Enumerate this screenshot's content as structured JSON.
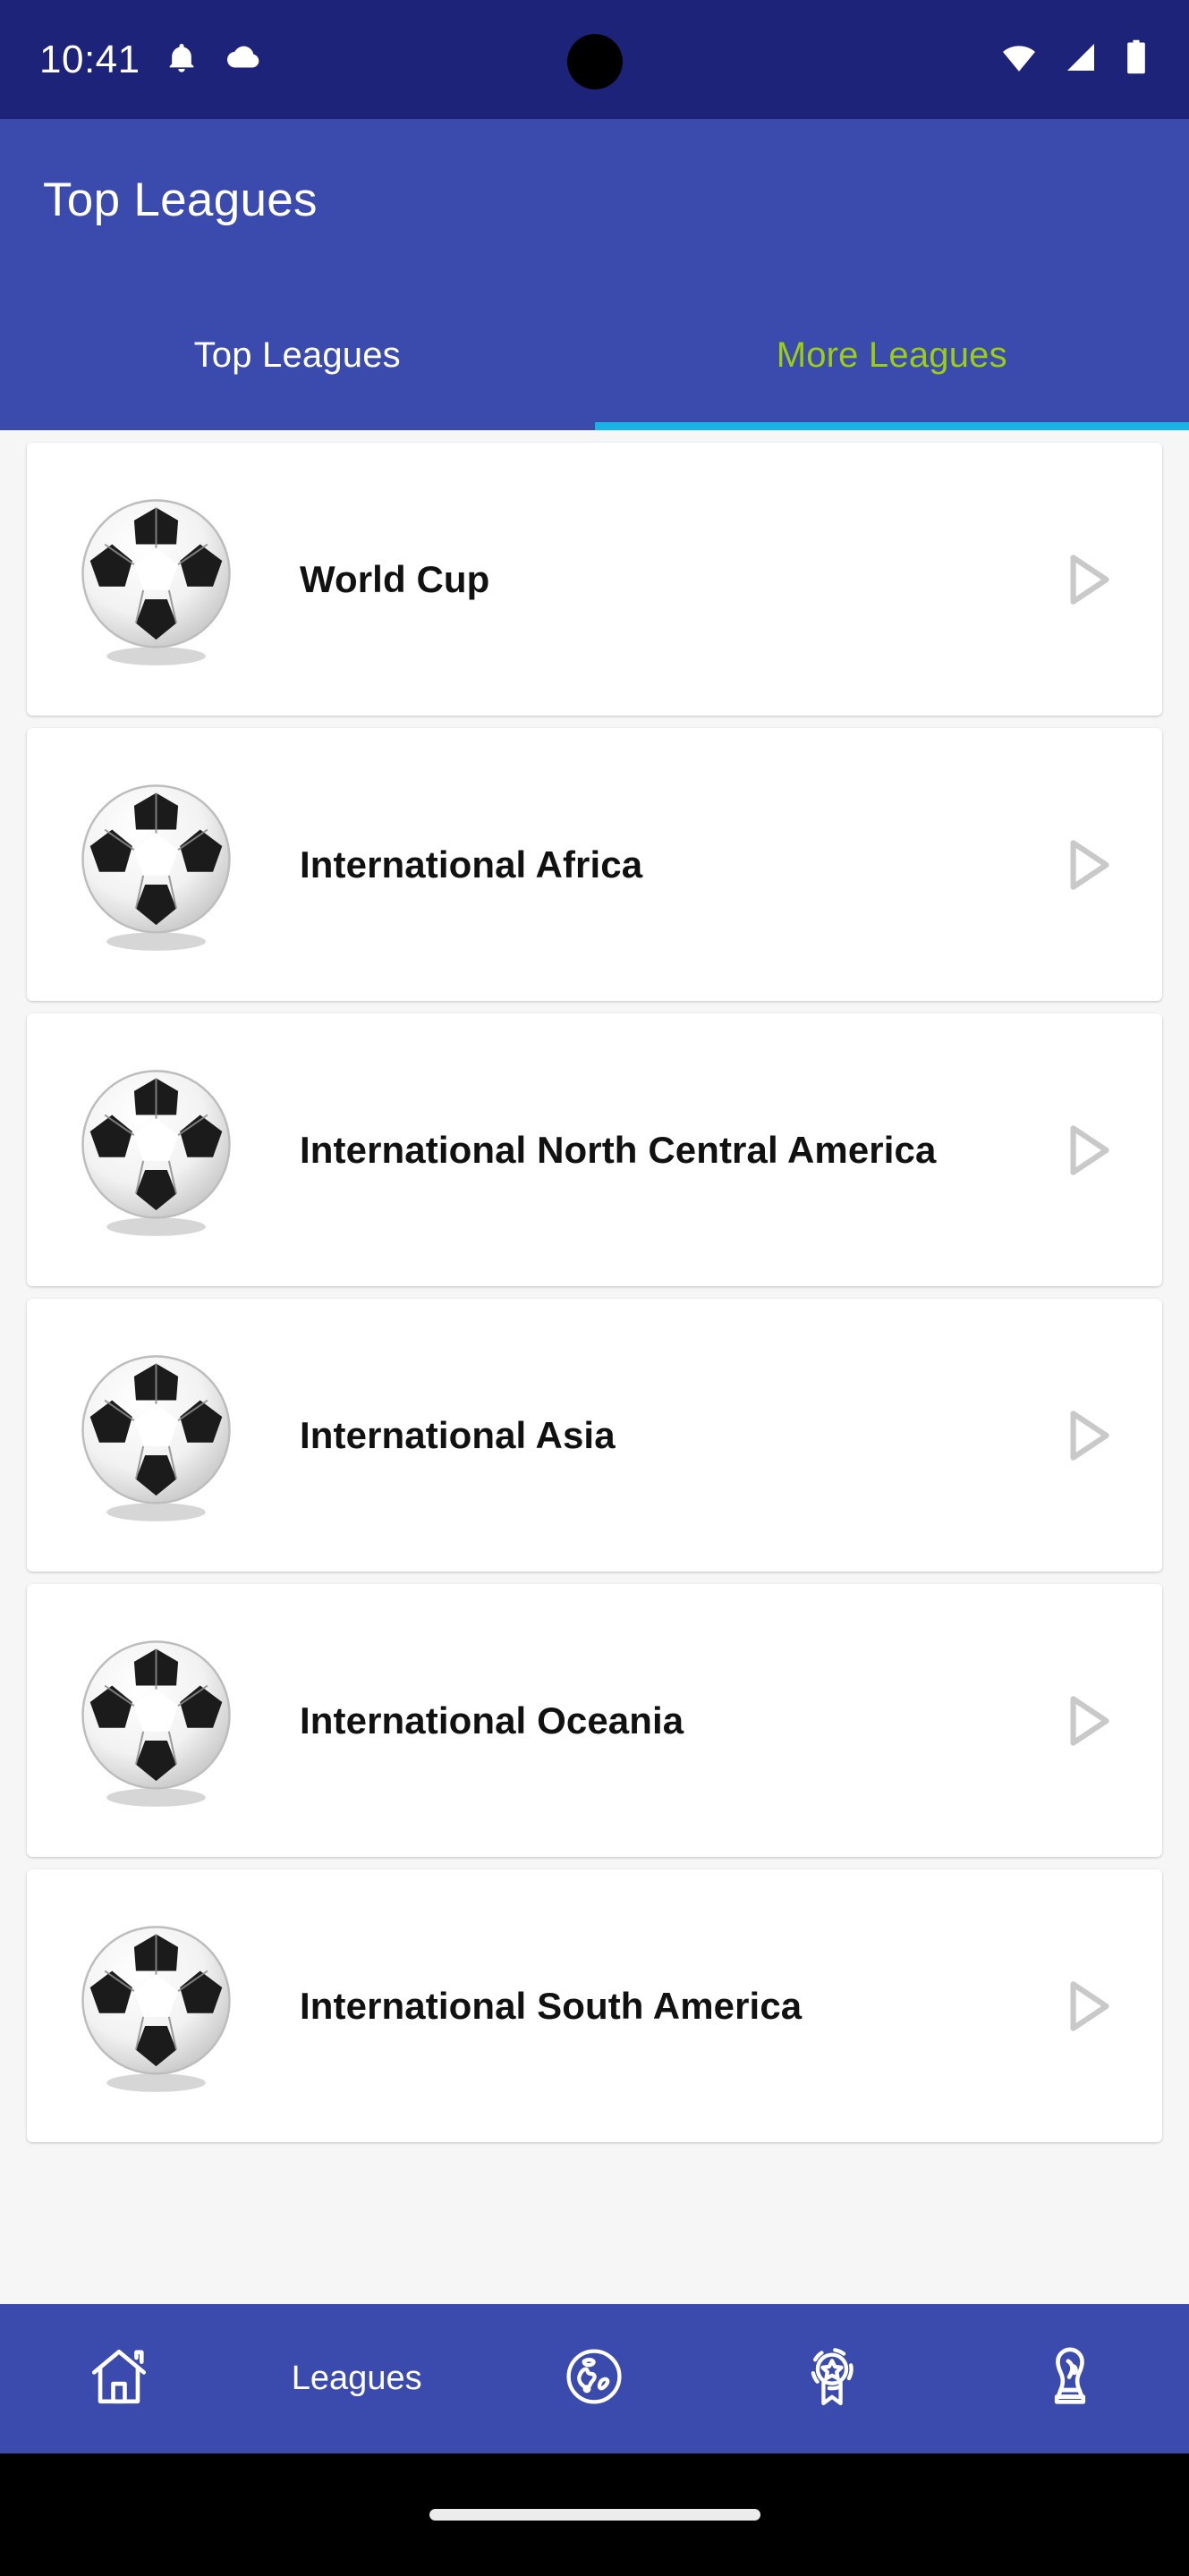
{
  "status_bar": {
    "time": "10:41",
    "left_icons": [
      "bell-icon",
      "cloud-icon"
    ],
    "right_icons": [
      "wifi-icon",
      "cellular-signal-icon",
      "battery-icon"
    ],
    "background_color": "#1c2379"
  },
  "app_bar": {
    "title": "Top Leagues",
    "background_color": "#3a4bad",
    "title_color": "#ffffff"
  },
  "tabs": {
    "items": [
      {
        "label": "Top Leagues",
        "active": false
      },
      {
        "label": "More Leagues",
        "active": true
      }
    ],
    "active_color": "#9bcd12",
    "inactive_color": "#ffffff",
    "indicator_color": "#17b3e6"
  },
  "leagues": [
    {
      "name": "World Cup",
      "icon": "soccer-ball-icon",
      "action": "play-icon"
    },
    {
      "name": "International Africa",
      "icon": "soccer-ball-icon",
      "action": "play-icon"
    },
    {
      "name": "International North Central America",
      "icon": "soccer-ball-icon",
      "action": "play-icon"
    },
    {
      "name": "International Asia",
      "icon": "soccer-ball-icon",
      "action": "play-icon"
    },
    {
      "name": "International Oceania",
      "icon": "soccer-ball-icon",
      "action": "play-icon"
    },
    {
      "name": "International South America",
      "icon": "soccer-ball-icon",
      "action": "play-icon"
    }
  ],
  "bottom_nav": {
    "background_color": "#3a4bad",
    "items": [
      {
        "icon": "home-icon",
        "label": ""
      },
      {
        "icon": "",
        "label": "Leagues"
      },
      {
        "icon": "globe-icon",
        "label": ""
      },
      {
        "icon": "medal-badge-icon",
        "label": ""
      },
      {
        "icon": "trophy-icon",
        "label": ""
      }
    ]
  },
  "list_background_color": "#f6f6f7",
  "card_background_color": "#ffffff",
  "card_text_color": "#111111",
  "play_icon_color": "#c9c9c9"
}
